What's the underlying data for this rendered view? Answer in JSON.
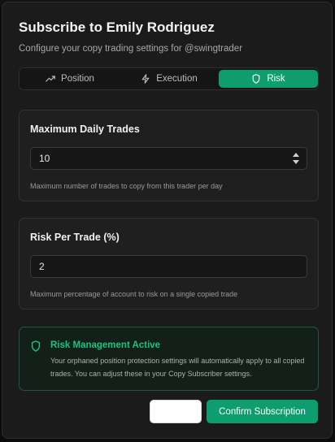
{
  "modal": {
    "title": "Subscribe to Emily Rodriguez",
    "subtitle": "Configure your copy trading settings for @swingtrader"
  },
  "tabs": [
    {
      "label": "Position",
      "icon": "trending-up-icon",
      "active": false
    },
    {
      "label": "Execution",
      "icon": "lightning-icon",
      "active": false
    },
    {
      "label": "Risk",
      "icon": "shield-icon",
      "active": true
    }
  ],
  "max_daily_trades": {
    "label": "Maximum Daily Trades",
    "value": "10",
    "help": "Maximum number of trades to copy from this trader per day"
  },
  "risk_per_trade": {
    "label": "Risk Per Trade (%)",
    "value": "2",
    "help": "Maximum percentage of account to risk on a single copied trade"
  },
  "notice": {
    "title": "Risk Management Active",
    "text": "Your orphaned position protection settings will automatically apply to all copied trades. You can adjust these in your Copy Subscriber settings.",
    "icon": "shield-icon"
  },
  "footer": {
    "cancel_label": "",
    "confirm_label": "Confirm Subscription"
  },
  "colors": {
    "accent": "#0e9d6e",
    "notice_title": "#19c37d",
    "background": "#1b1b1b"
  }
}
